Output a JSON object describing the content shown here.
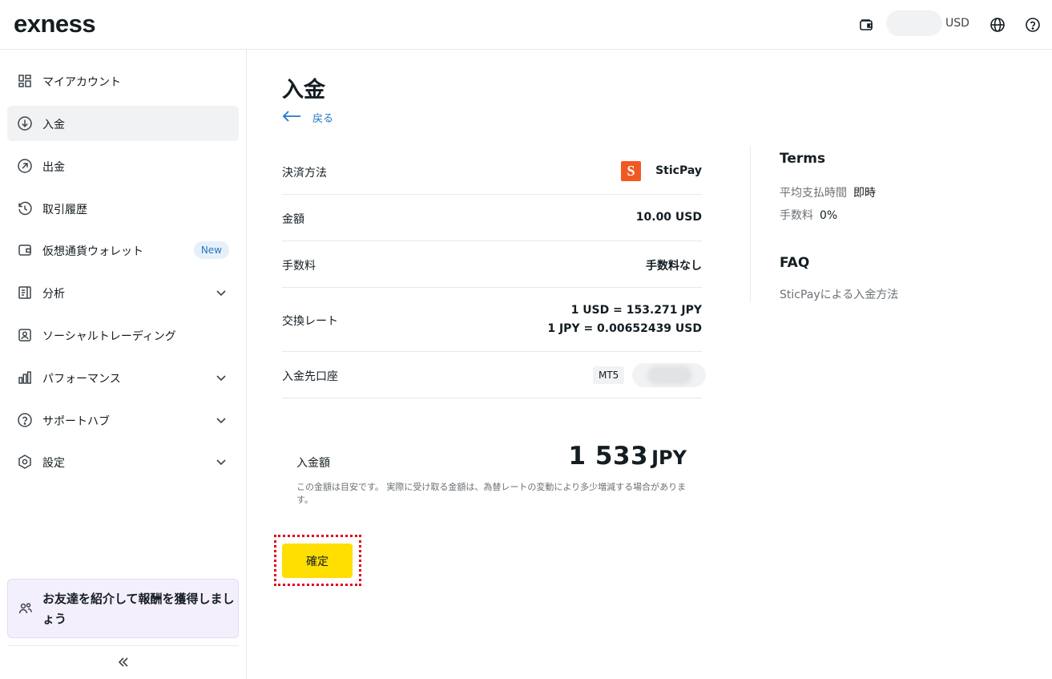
{
  "header": {
    "logo": "exness",
    "currency": "USD",
    "icons": [
      "wallet-icon",
      "globe-icon",
      "help-icon"
    ]
  },
  "sidebar": {
    "items": [
      {
        "label": "マイアカウント",
        "icon": "dashboard-icon"
      },
      {
        "label": "入金",
        "icon": "deposit-icon",
        "active": true
      },
      {
        "label": "出金",
        "icon": "withdraw-icon"
      },
      {
        "label": "取引履歴",
        "icon": "history-icon"
      },
      {
        "label": "仮想通貨ウォレット",
        "icon": "wallet-icon",
        "badge": "New"
      },
      {
        "label": "分析",
        "icon": "analytics-icon",
        "expandable": true
      },
      {
        "label": "ソーシャルトレーディング",
        "icon": "social-trading-icon"
      },
      {
        "label": "パフォーマンス",
        "icon": "performance-icon",
        "expandable": true
      },
      {
        "label": "サポートハブ",
        "icon": "support-icon",
        "expandable": true
      },
      {
        "label": "設定",
        "icon": "settings-icon",
        "expandable": true
      }
    ],
    "referral": "お友達を紹介して報酬を獲得しましょう"
  },
  "main": {
    "title": "入金",
    "back_label": "戻る",
    "rows": {
      "method_label": "決済方法",
      "method_value": "SticPay",
      "amount_label": "金額",
      "amount_value": "10.00 USD",
      "fee_label": "手数料",
      "fee_value": "手数料なし",
      "rate_label": "交換レート",
      "rate_line1": "1 USD = 153.271 JPY",
      "rate_line2": "1 JPY = 0.00652439 USD",
      "account_label": "入金先口座",
      "account_type": "MT5"
    },
    "deposit_amount_label": "入金額",
    "deposit_amount": "1 533",
    "deposit_currency": "JPY",
    "disclaimer": "この金額は目安です。 実際に受け取る金額は、為替レートの変動により多少増減する場合があります。",
    "confirm_label": "確定"
  },
  "terms": {
    "heading": "Terms",
    "avg_time_label": "平均支払時間",
    "avg_time_value": "即時",
    "fee_label": "手数料",
    "fee_value": "0%",
    "faq_heading": "FAQ",
    "faq_link": "SticPayによる入金方法"
  },
  "colors": {
    "accent": "#ffde02",
    "link": "#2277c7",
    "highlight_frame": "#e0051c",
    "sticpay": "#f05a22"
  }
}
